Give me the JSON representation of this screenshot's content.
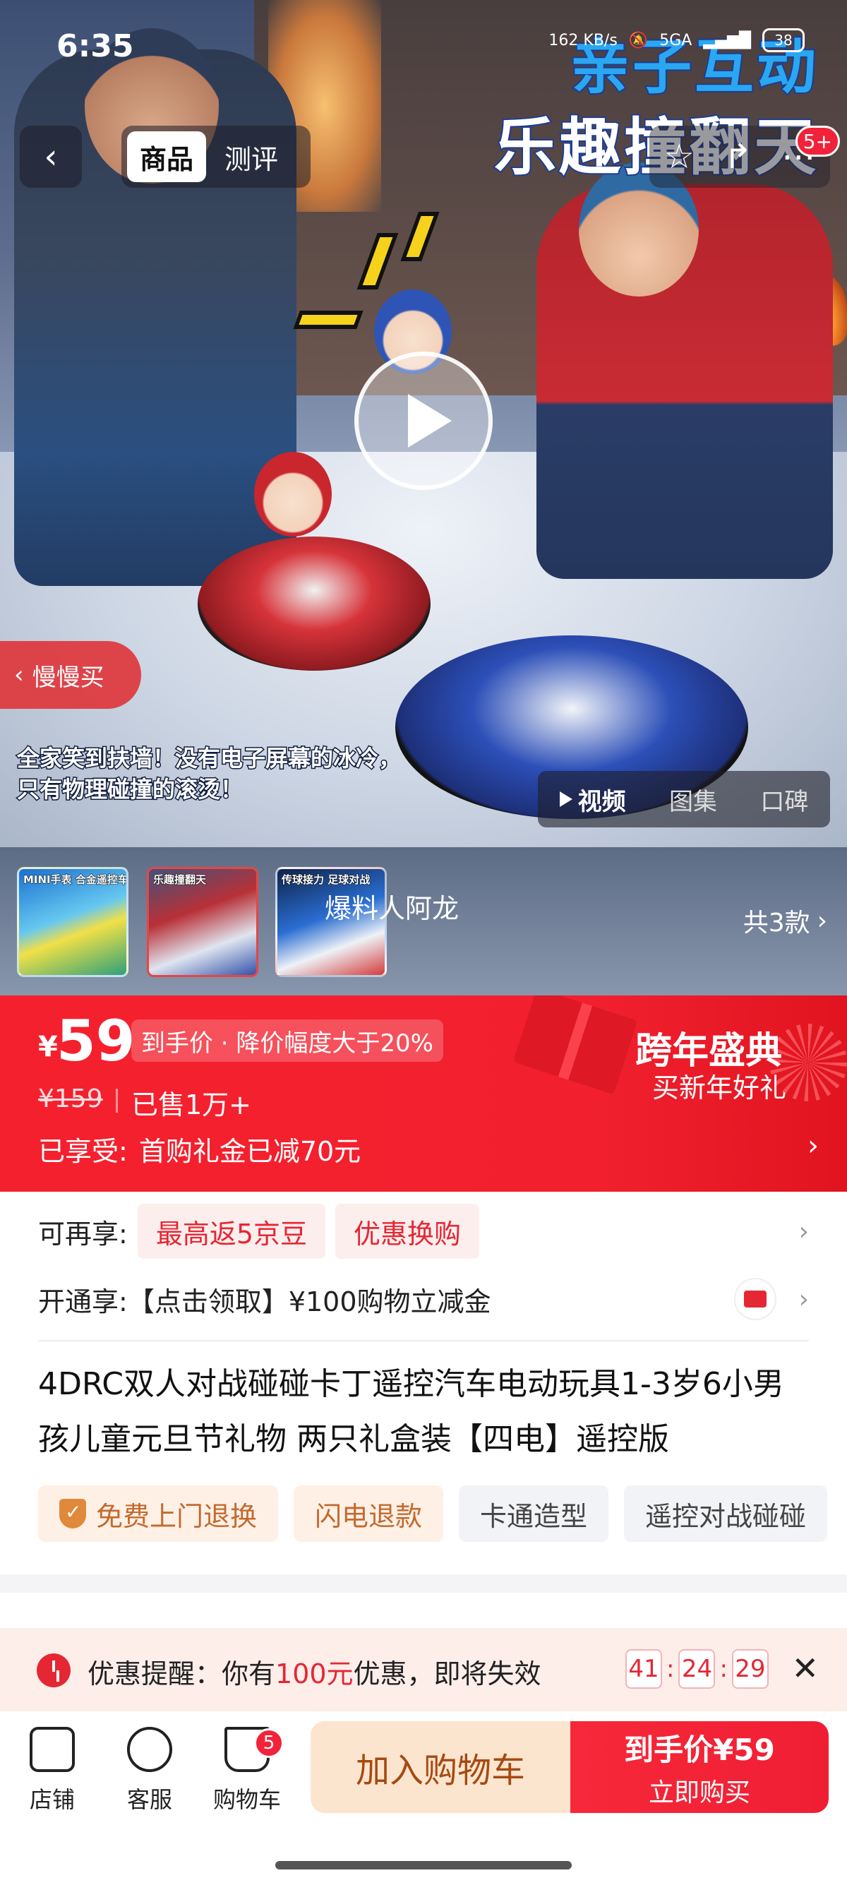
{
  "status_bar": {
    "time": "6:35",
    "speed": "162 KB/s",
    "network": "5GA",
    "battery": "38"
  },
  "top_nav": {
    "tabs": [
      "商品",
      "测评"
    ],
    "active_tab": "商品",
    "more_badge": "5+"
  },
  "hero": {
    "promo_line1": "亲子互动",
    "promo_line2": "乐趣撞翻天",
    "caption": "全家笑到扶墙！没有电子屏幕的冰冷，只有物理碰撞的滚烫！",
    "slow_buy": "慢慢买",
    "media_tabs": [
      "视频",
      "图集",
      "口碑"
    ],
    "active_media_tab": "视频"
  },
  "variants": {
    "thumbs": [
      {
        "label": "MINI手表 合金遥控车"
      },
      {
        "label": "乐趣撞翻天"
      },
      {
        "label": "传球接力 足球对战"
      }
    ],
    "author": "爆料人阿龙",
    "count_label": "共3款"
  },
  "price": {
    "currency": "¥",
    "value": "59",
    "tag": "到手价 · 降价幅度大于20%",
    "original": "¥159",
    "sold": "已售1万+",
    "enjoyed_label": "已享受:",
    "enjoyed_value": "首购礼金已减70元",
    "festival": "跨年盛典",
    "festival_sub": "买新年好礼"
  },
  "benefits": {
    "row1_label": "可再享:",
    "row1_chips": [
      "最高返5京豆",
      "优惠换购"
    ],
    "row2_label": "开通享:",
    "row2_text": "【点击领取】¥100购物立减金"
  },
  "product": {
    "title": "4DRC双人对战碰碰卡丁遥控汽车电动玩具1-3岁6小男孩儿童元旦节礼物 两只礼盒装【四电】遥控版",
    "tags": [
      {
        "label": "免费上门退换",
        "style": "orange"
      },
      {
        "label": "闪电退款",
        "style": "orange"
      },
      {
        "label": "卡通造型",
        "style": "gray"
      },
      {
        "label": "遥控对战碰碰",
        "style": "gray"
      }
    ]
  },
  "reminder": {
    "prefix": "优惠提醒：你有",
    "amount": "100元",
    "suffix": "优惠，即将失效",
    "timer": [
      "41",
      "24",
      "29"
    ]
  },
  "bottom_bar": {
    "store": "店铺",
    "service": "客服",
    "cart": "购物车",
    "cart_badge": "5",
    "add_to_cart": "加入购物车",
    "buy_line1": "到手价¥59",
    "buy_line2": "立即购买"
  },
  "colors": {
    "accent_red": "#f5202e",
    "light_red_bg": "#fdeeee",
    "orange_tag_bg": "#fff0e6",
    "add_cart_bg": "#fce5cf"
  }
}
